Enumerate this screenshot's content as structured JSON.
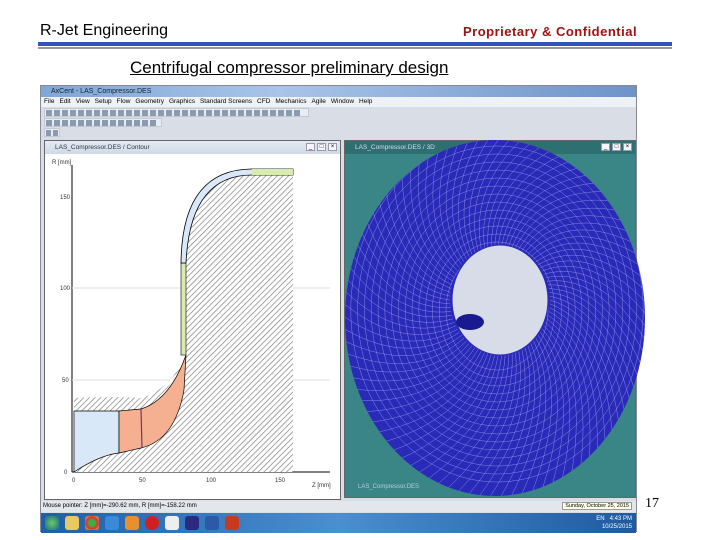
{
  "slide": {
    "header_left": "R-Jet Engineering",
    "header_right": "Proprietary & Confidential",
    "title": "Centrifugal compressor preliminary design",
    "page_number": "17"
  },
  "app": {
    "title": "AxCent - LAS_Compressor.DES",
    "menu": [
      "File",
      "Edit",
      "View",
      "Setup",
      "Flow",
      "Geometry",
      "Graphics",
      "Standard Screens",
      "CFD",
      "Mechanics",
      "Agile",
      "Window",
      "Help"
    ],
    "meridional_window": {
      "title": "LAS_Compressor.DES / Contour",
      "y_axis_label": "R [mm]",
      "x_axis_label": "Z [mm]",
      "y_ticks": [
        "0",
        "50",
        "100",
        "150"
      ],
      "x_ticks": [
        "0",
        "50",
        "100",
        "150"
      ]
    },
    "view3d_window": {
      "title": "LAS_Compressor.DES / 3D",
      "caption": "LAS_Compressor.DES"
    },
    "status_text": "Mouse pointer: Z [mm]=-290.62 mm, R [mm]=-158.22 mm",
    "tooltip": "Sunday, October 25, 2015",
    "clock_time": "4:43 PM",
    "clock_date": "10/25/2015",
    "lang": "EN"
  },
  "colors": {
    "accent": "#3355bb",
    "confidential": "#a01010",
    "view_bg": "#3a8585",
    "mesh": "#2a2ab8"
  }
}
